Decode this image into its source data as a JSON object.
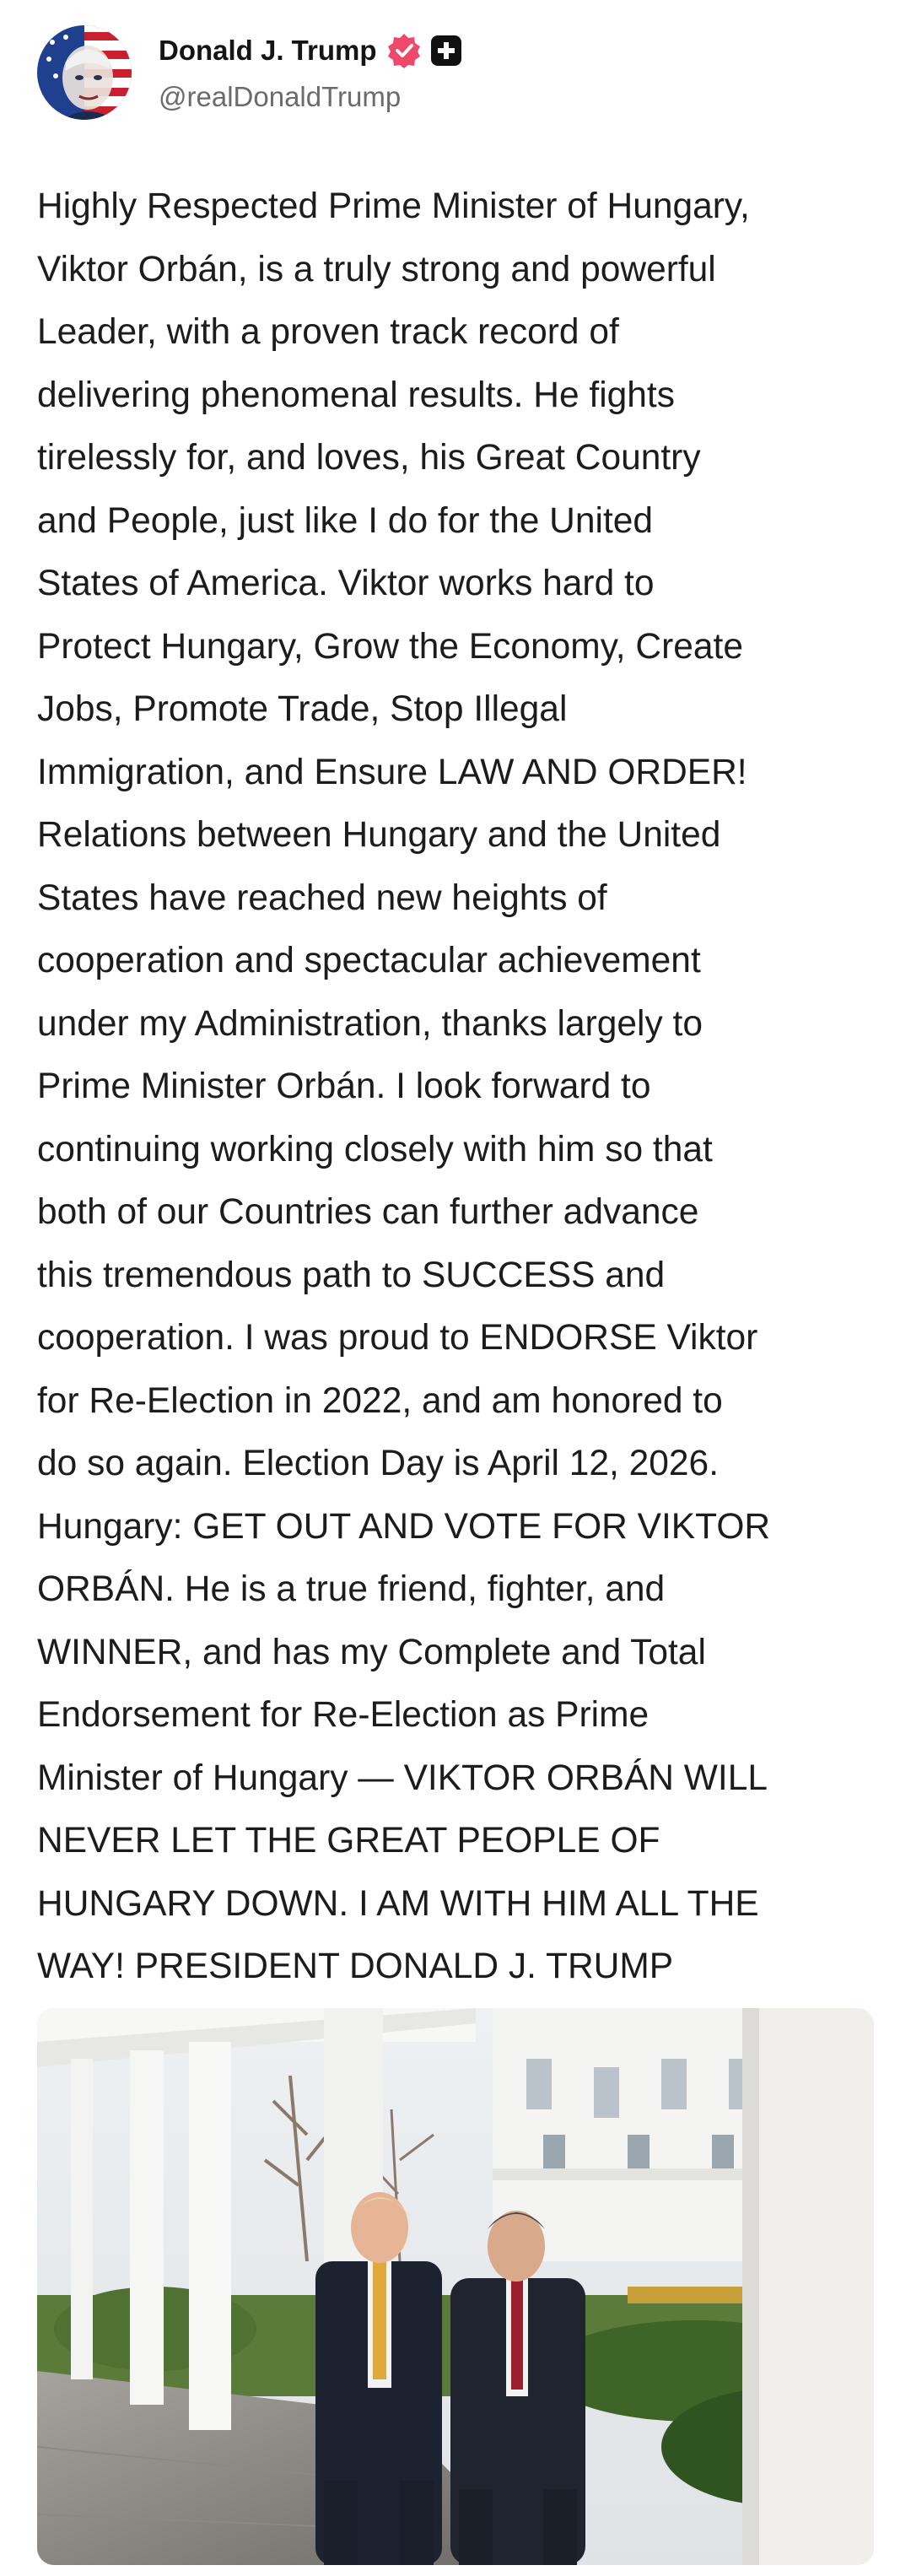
{
  "author": {
    "display_name": "Donald J. Trump",
    "handle": "@realDonaldTrump",
    "avatar_icon": "flag-portrait-avatar",
    "badges": [
      "verified-badge-icon",
      "plus-badge-icon"
    ],
    "verified_color": "#f0486a"
  },
  "post": {
    "text": "Highly Respected Prime Minister of Hungary,\nViktor Orbán, is a truly strong and powerful\nLeader, with a proven track record of\ndelivering phenomenal results. He fights\ntirelessly for, and loves, his Great Country\nand People, just like I do for the United\nStates of America. Viktor works hard to\nProtect Hungary, Grow the Economy, Create\nJobs, Promote Trade, Stop Illegal\nImmigration, and Ensure LAW AND ORDER!\nRelations between Hungary and the United\nStates have reached new heights of\ncooperation and spectacular achievement\nunder my Administration, thanks largely to\nPrime Minister Orbán. I look forward to\ncontinuing working closely with him so that\nboth of our Countries can further advance\nthis tremendous path to SUCCESS and\ncooperation. I was proud to ENDORSE Viktor\nfor Re-Election in 2022, and am honored to\ndo so again. Election Day is April 12, 2026.\nHungary: GET OUT AND VOTE FOR VIKTOR\nORBÁN. He is a true friend, fighter, and\nWINNER, and has my Complete and Total\nEndorsement for Re-Election as Prime\nMinister of Hungary — VIKTOR ORBÁN WILL\nNEVER LET THE GREAT PEOPLE OF\nHUNGARY DOWN. I AM WITH HIM ALL THE\nWAY! PRESIDENT DONALD J. TRUMP",
    "media_icon": "colonnade-photo-two-men"
  }
}
